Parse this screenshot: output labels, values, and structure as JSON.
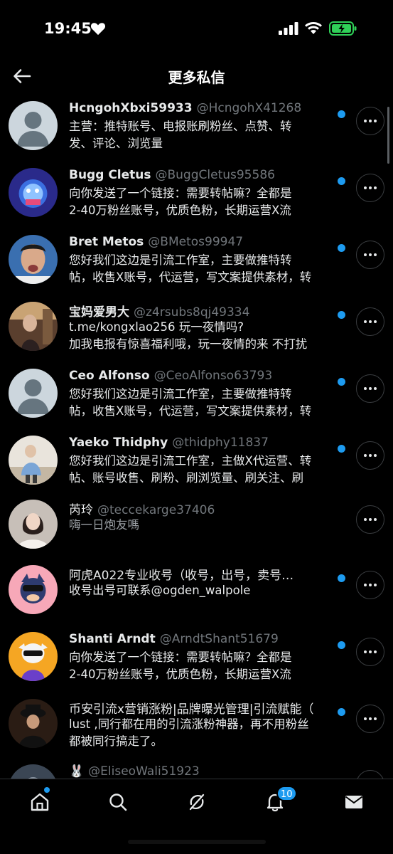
{
  "status_bar": {
    "time": "19:45"
  },
  "header": {
    "title": "更多私信"
  },
  "conversations": [
    {
      "name": "HcngohXbxi59933",
      "handle": "@HcngohX41268",
      "line1": "主营：推特账号、电报账刷粉丝、点赞、转",
      "line2": "发、评论、浏览量",
      "unread": true
    },
    {
      "name": "Bugg Cletus",
      "handle": "@BuggCletus95586",
      "line1": "向你发送了一个链接：需要转帖嘛？全都是",
      "line2": "2-40万粉丝账号，优质色粉，长期运营X流",
      "unread": true
    },
    {
      "name": "Bret Metos",
      "handle": "@BMetos99947",
      "line1": "您好我们这边是引流工作室，主要做推特转",
      "line2": "帖，收售X账号，代运营，写文案提供素材，转",
      "unread": true
    },
    {
      "name": "宝妈爱男大",
      "handle": "@z4rsubs8qj49334",
      "line1": "t.me/kongxlao256 玩一夜情吗?",
      "line2": "加我电报有惊喜福利哦，玩一夜情的来 不打扰",
      "unread": true
    },
    {
      "name": "Ceo Alfonso",
      "handle": "@CeoAlfonso63793",
      "line1": "您好我们这边是引流工作室，主要做推特转",
      "line2": "帖，收售X账号，代运营，写文案提供素材，转",
      "unread": true
    },
    {
      "name": "Yaeko Thidphy",
      "handle": "@thidphy11837",
      "line1": "您好我们这边是引流工作室，主做X代运营、转",
      "line2": "帖、账号收售、刷粉、刷浏览量、刷关注、刷",
      "unread": true
    },
    {
      "name": "芮玲",
      "handle": "@teccekarge37406",
      "line1": "嗨一日炮友嗎",
      "line2": "",
      "unread": false
    },
    {
      "name": "阿虎A022专业收号（收号，出号，卖号…",
      "handle": "",
      "line1": "收号出号可联系@ogden_walpole",
      "line2": "",
      "unread": true
    },
    {
      "name": "Shanti Arndt",
      "handle": "@ArndtShant51679",
      "line1": "向你发送了一个链接：需要转帖嘛？全都是",
      "line2": "2-40万粉丝账号，优质色粉，长期运营X流",
      "unread": true
    },
    {
      "name": "币安引流x营销涨粉|品牌曝光管理|引流赋能（",
      "handle": "",
      "line1": "lust ,同行都在用的引流涨粉神器，再不用粉丝",
      "line2": "都被同行搞走了。",
      "unread": true
    },
    {
      "name": "🐰",
      "handle": "@EliseoWali51923",
      "line1": "",
      "line2": "",
      "unread": false
    }
  ],
  "tabbar": {
    "notifications_badge": "10"
  },
  "colors": {
    "accent": "#1d9bf0",
    "background": "#000000",
    "secondary_text": "#71767b"
  },
  "icons": [
    "back-arrow-icon",
    "home-icon",
    "search-icon",
    "grok-icon",
    "bell-icon",
    "mail-icon",
    "more-dots-icon",
    "heart-icon",
    "signal-icon",
    "wifi-icon",
    "battery-icon"
  ]
}
